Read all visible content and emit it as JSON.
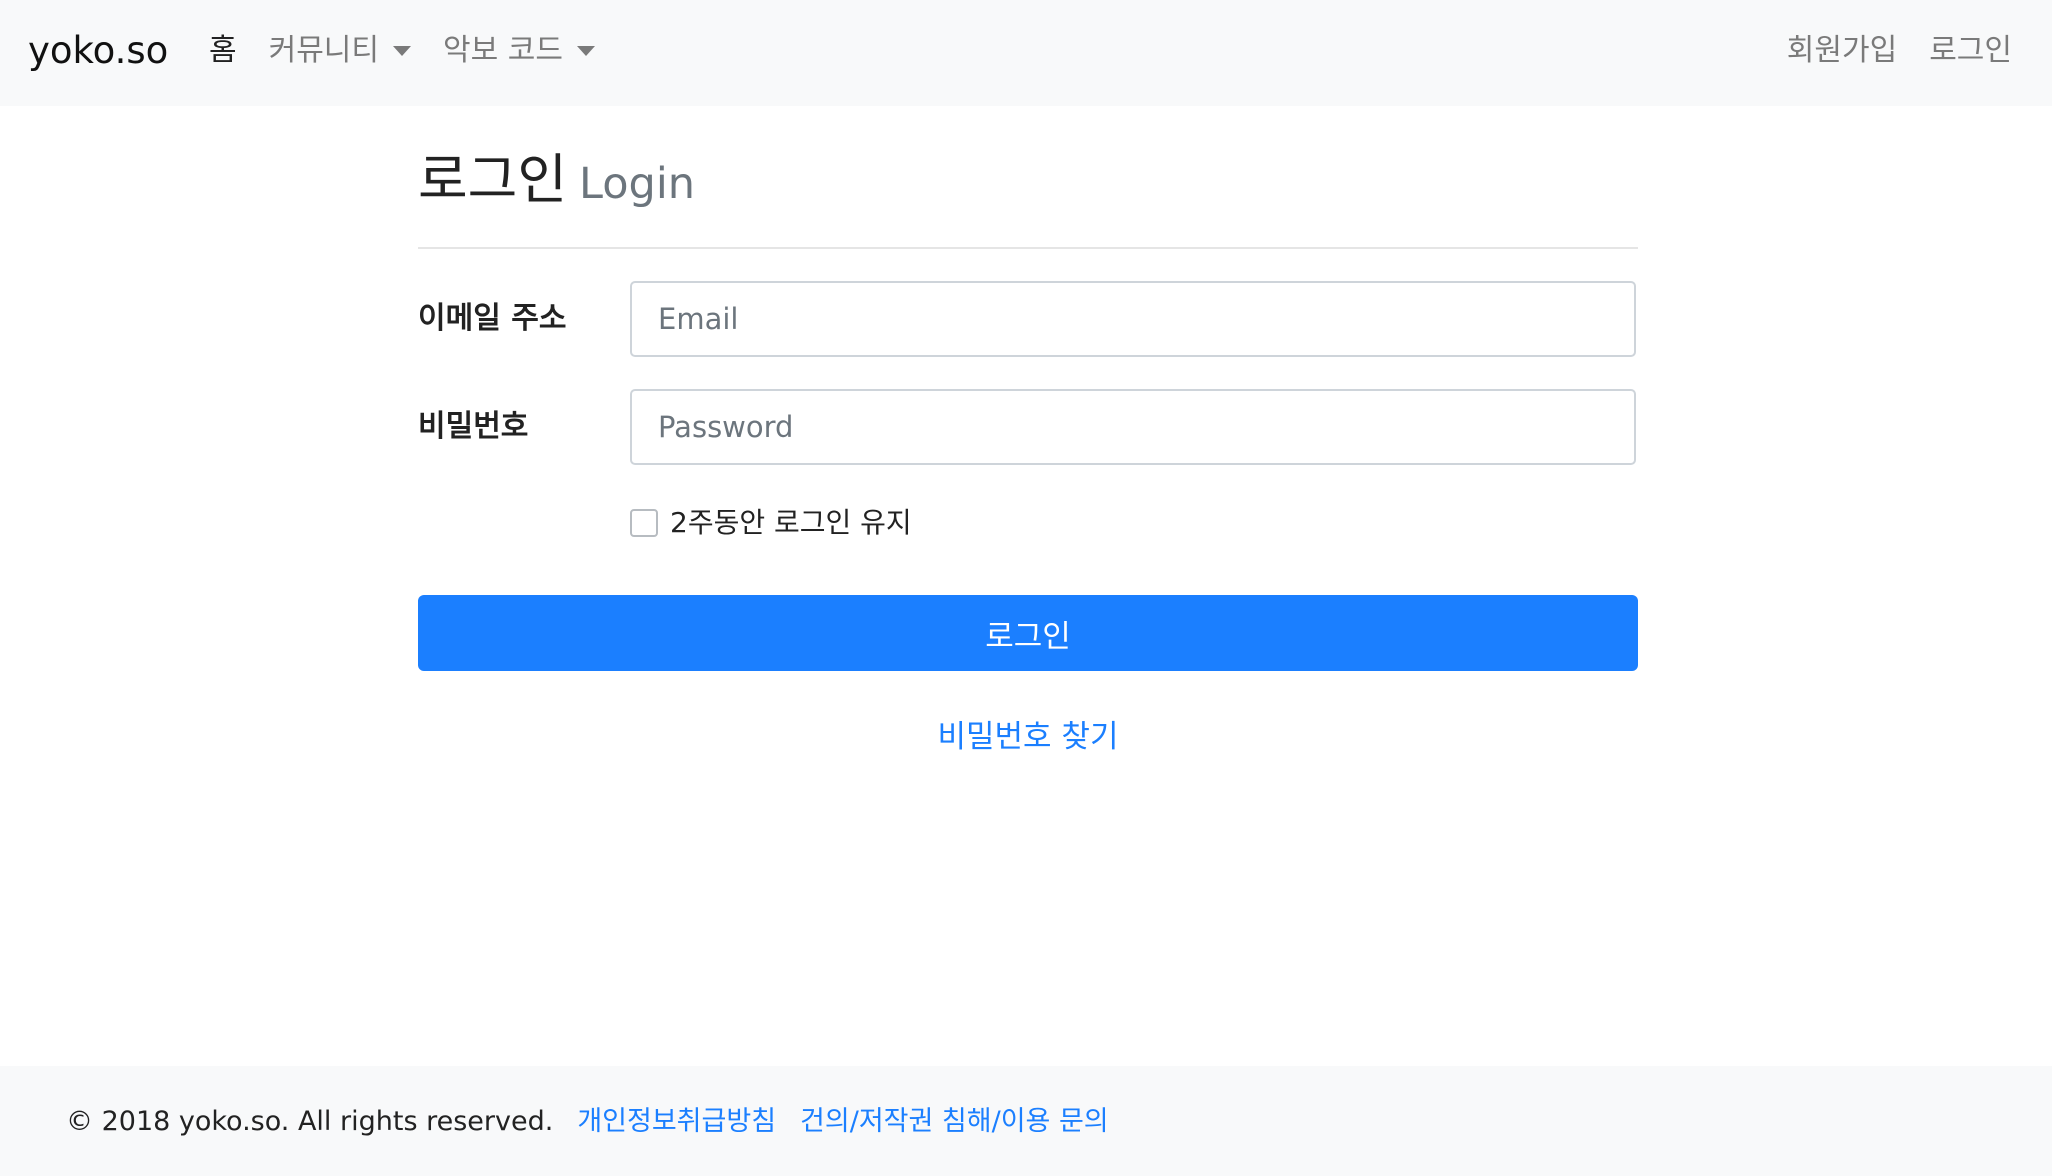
{
  "navbar": {
    "brand": "yoko.so",
    "left_items": [
      {
        "label": "홈",
        "active": true,
        "dropdown": false
      },
      {
        "label": "커뮤니티",
        "active": false,
        "dropdown": true
      },
      {
        "label": "악보 코드",
        "active": false,
        "dropdown": true
      }
    ],
    "right_items": [
      {
        "label": "회원가입"
      },
      {
        "label": "로그인"
      }
    ]
  },
  "page": {
    "title_ko": "로그인",
    "title_en": "Login"
  },
  "form": {
    "email_label": "이메일 주소",
    "email_placeholder": "Email",
    "email_value": "",
    "password_label": "비밀번호",
    "password_placeholder": "Password",
    "password_value": "",
    "remember_label": "2주동안 로그인 유지",
    "remember_checked": false,
    "submit_label": "로그인",
    "find_password_label": "비밀번호 찾기"
  },
  "footer": {
    "copyright": "© 2018 yoko.so. All rights reserved.",
    "links": [
      {
        "label": "개인정보취급방침"
      },
      {
        "label": "건의/저작권 침해/이용 문의"
      }
    ]
  },
  "colors": {
    "primary": "#1b7fff",
    "navbar_bg": "#f8f9fa",
    "footer_bg": "#f8f9fa",
    "muted_text": "#6c757d"
  }
}
